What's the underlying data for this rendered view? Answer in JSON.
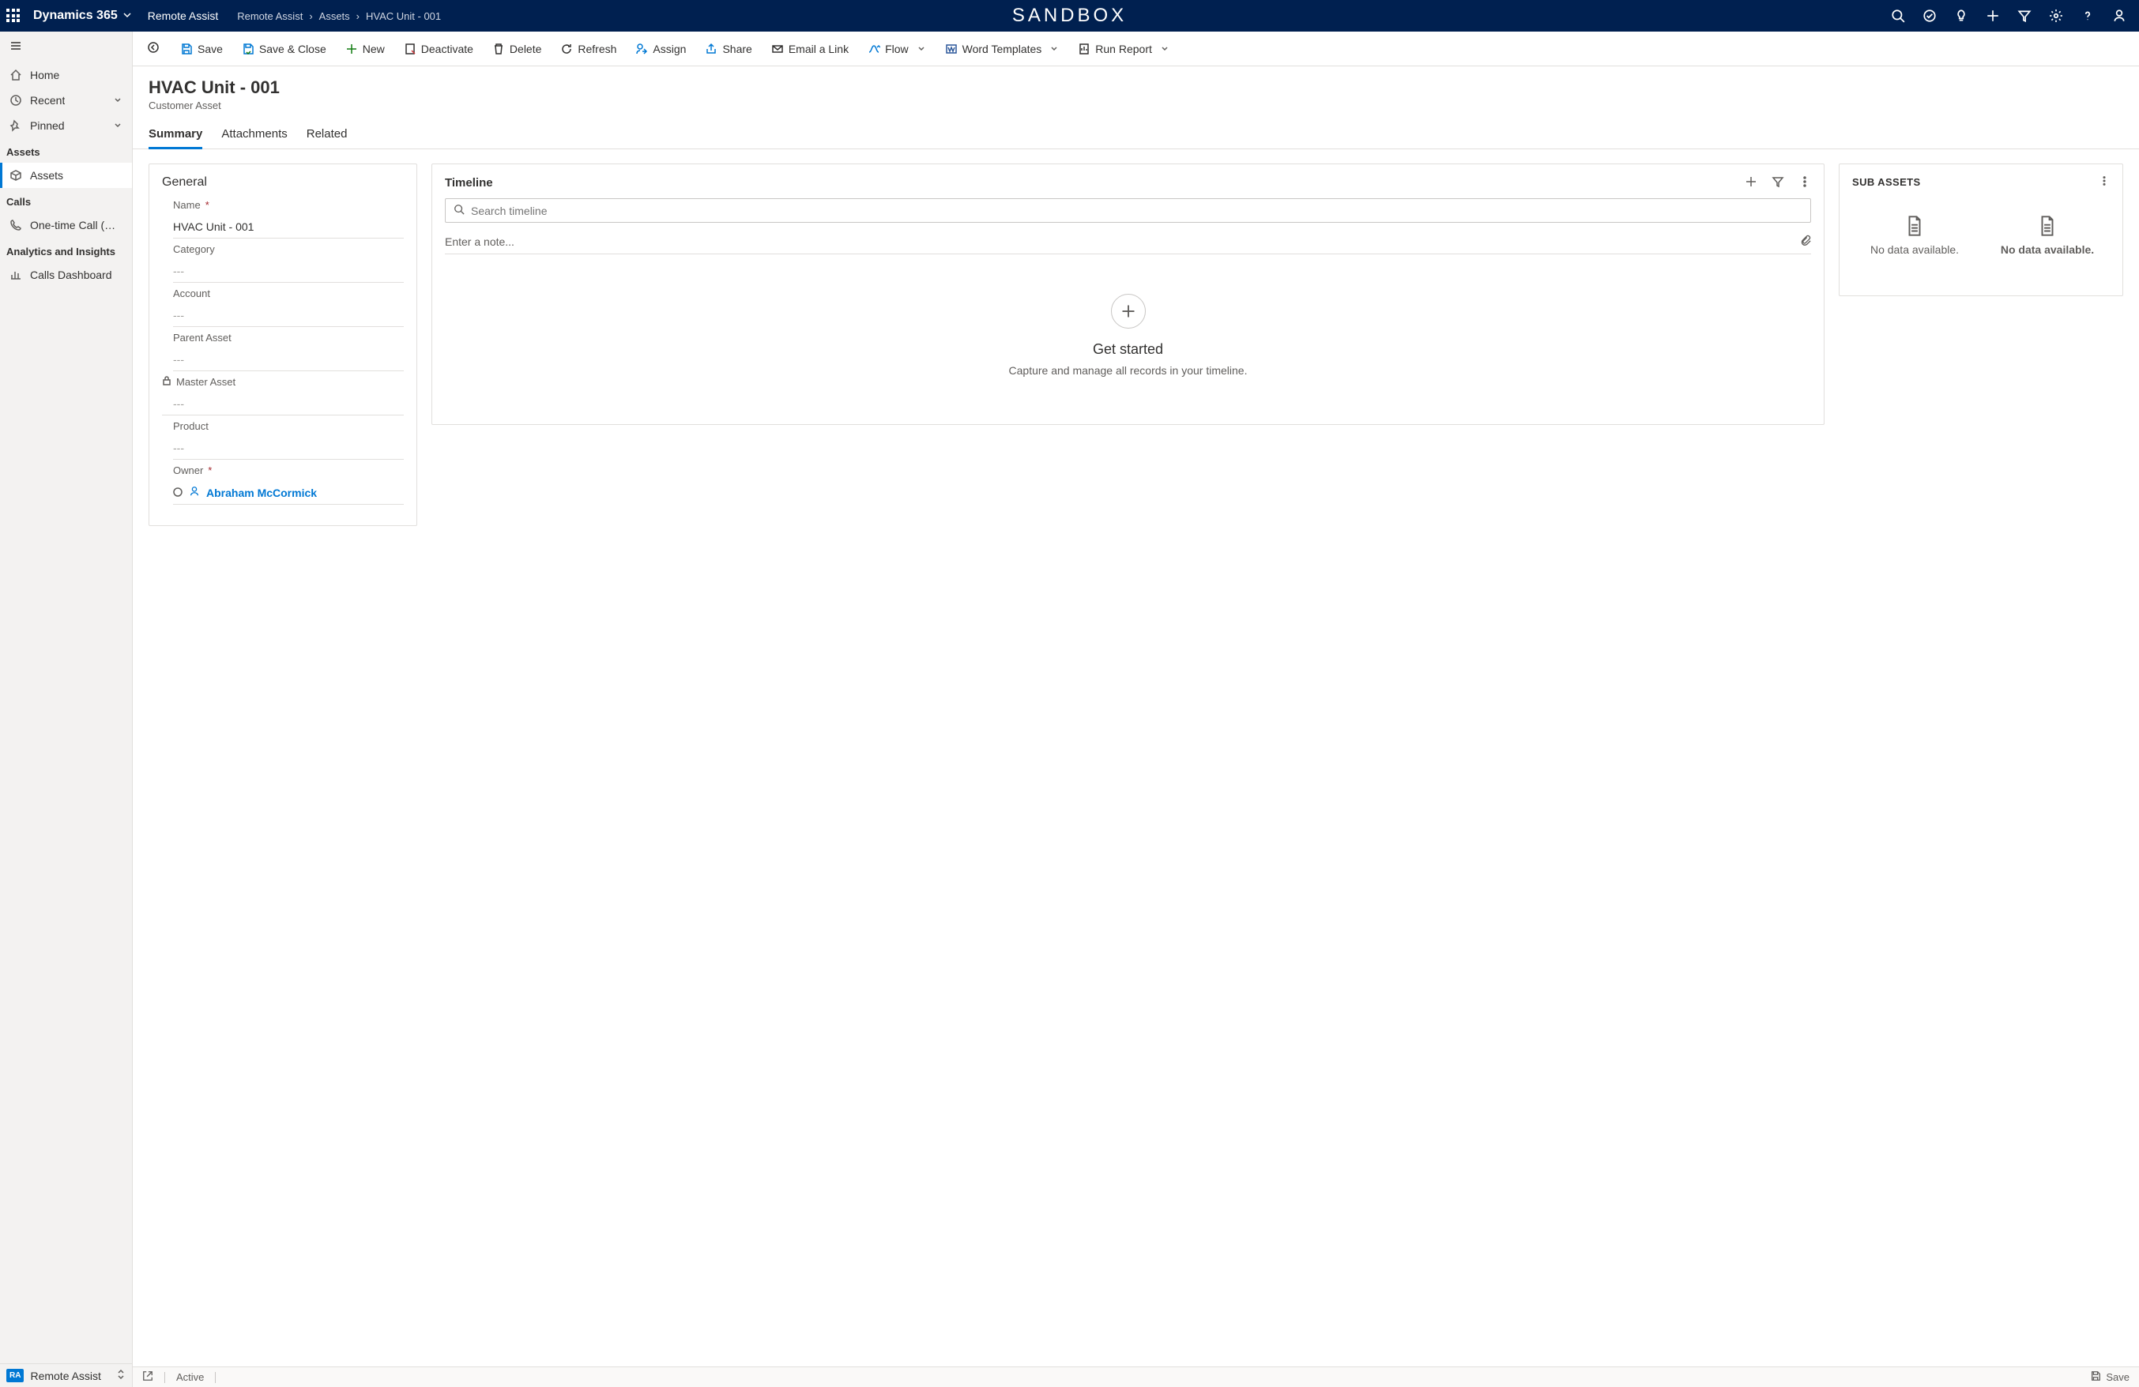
{
  "topbar": {
    "brand": "Dynamics 365",
    "app_name": "Remote Assist",
    "sandbox_label": "SANDBOX",
    "breadcrumbs": [
      "Remote Assist",
      "Assets",
      "HVAC Unit - 001"
    ]
  },
  "sidebar": {
    "items_top": [
      {
        "icon": "home",
        "label": "Home"
      },
      {
        "icon": "clock",
        "label": "Recent",
        "expandable": true
      },
      {
        "icon": "pin",
        "label": "Pinned",
        "expandable": true
      }
    ],
    "sections": [
      {
        "title": "Assets",
        "items": [
          {
            "icon": "cube",
            "label": "Assets",
            "selected": true
          }
        ]
      },
      {
        "title": "Calls",
        "items": [
          {
            "icon": "phone",
            "label": "One-time Call (Previ..."
          }
        ]
      },
      {
        "title": "Analytics and Insights",
        "items": [
          {
            "icon": "chart",
            "label": "Calls Dashboard"
          }
        ]
      }
    ],
    "bottom": {
      "badge": "RA",
      "label": "Remote Assist"
    }
  },
  "commandbar": {
    "save": "Save",
    "save_close": "Save & Close",
    "new": "New",
    "deactivate": "Deactivate",
    "delete": "Delete",
    "refresh": "Refresh",
    "assign": "Assign",
    "share": "Share",
    "email_link": "Email a Link",
    "flow": "Flow",
    "word_templates": "Word Templates",
    "run_report": "Run Report"
  },
  "header": {
    "title": "HVAC Unit - 001",
    "subtitle": "Customer Asset"
  },
  "tabs": [
    "Summary",
    "Attachments",
    "Related"
  ],
  "general": {
    "title": "General",
    "fields": {
      "name_label": "Name",
      "name_value": "HVAC Unit - 001",
      "category_label": "Category",
      "category_value": "---",
      "account_label": "Account",
      "account_value": "---",
      "parent_asset_label": "Parent Asset",
      "parent_asset_value": "---",
      "master_asset_label": "Master Asset",
      "master_asset_value": "---",
      "product_label": "Product",
      "product_value": "---",
      "owner_label": "Owner",
      "owner_value": "Abraham McCormick"
    }
  },
  "timeline": {
    "title": "Timeline",
    "search_placeholder": "Search timeline",
    "note_placeholder": "Enter a note...",
    "get_started": "Get started",
    "get_started_sub": "Capture and manage all records in your timeline."
  },
  "subassets": {
    "title": "SUB ASSETS",
    "nodata1": "No data available.",
    "nodata2": "No data available."
  },
  "statusbar": {
    "status": "Active",
    "save": "Save"
  }
}
